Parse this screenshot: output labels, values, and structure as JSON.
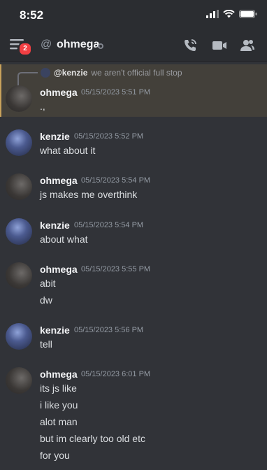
{
  "status_bar": {
    "time": "8:52"
  },
  "header": {
    "at_symbol": "@",
    "channel_name": "ohmega",
    "unread_badge": "2"
  },
  "icons": {
    "menu": "menu-icon",
    "call": "phone-call-icon",
    "video": "video-camera-icon",
    "members": "members-icon",
    "signal": "signal-icon",
    "wifi": "wifi-icon",
    "battery": "battery-icon"
  },
  "colors": {
    "background": "#313338",
    "highlight": "#43403a",
    "badge": "#f23f43"
  },
  "reply_preview": {
    "author": "@kenzie",
    "text": "we aren't official full stop"
  },
  "messages": [
    {
      "author": "ohmega",
      "timestamp": "05/15/2023 5:51 PM",
      "lines": [
        ".,"
      ]
    },
    {
      "author": "kenzie",
      "timestamp": "05/15/2023 5:52 PM",
      "lines": [
        "what about it"
      ]
    },
    {
      "author": "ohmega",
      "timestamp": "05/15/2023 5:54 PM",
      "lines": [
        "js makes me overthink"
      ]
    },
    {
      "author": "kenzie",
      "timestamp": "05/15/2023 5:54 PM",
      "lines": [
        "about what"
      ]
    },
    {
      "author": "ohmega",
      "timestamp": "05/15/2023 5:55 PM",
      "lines": [
        "abit",
        "dw"
      ]
    },
    {
      "author": "kenzie",
      "timestamp": "05/15/2023 5:56 PM",
      "lines": [
        "tell"
      ]
    },
    {
      "author": "ohmega",
      "timestamp": "05/15/2023 6:01 PM",
      "lines": [
        "its js like",
        "i like you",
        "alot man",
        "but im clearly too old etc",
        "for you"
      ]
    }
  ]
}
